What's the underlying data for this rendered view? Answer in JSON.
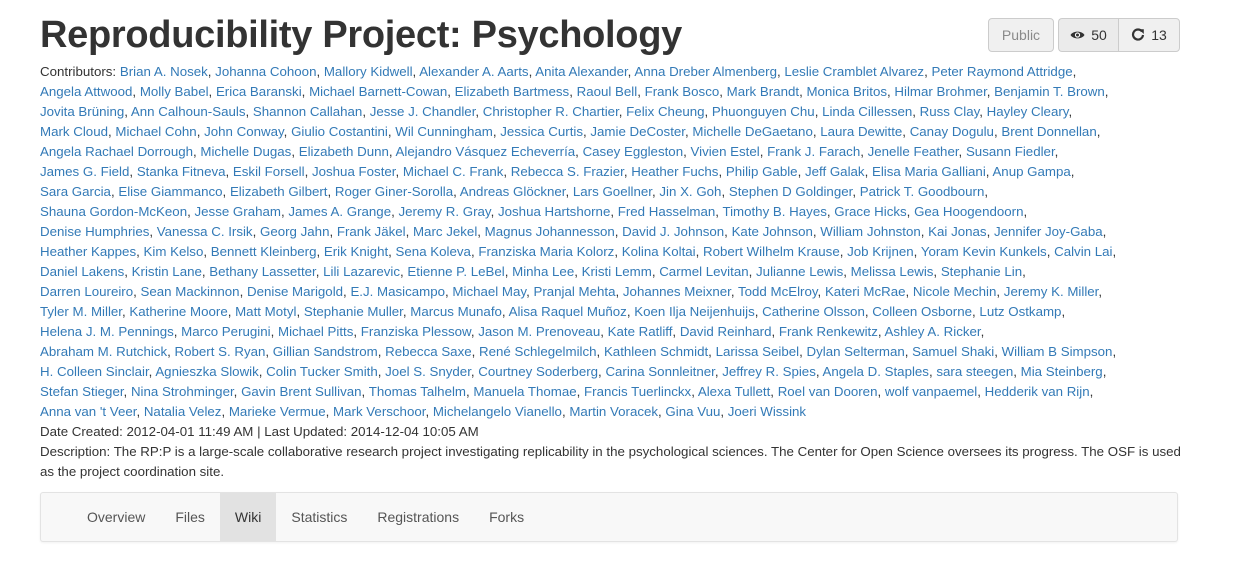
{
  "project": {
    "title": "Reproducibility Project: Psychology"
  },
  "actions": {
    "public_label": "Public",
    "watch_count": "50",
    "fork_count": "13"
  },
  "contributors": {
    "label": "Contributors:",
    "lines": [
      [
        "Brian A. Nosek",
        "Johanna Cohoon",
        "Mallory Kidwell",
        "Alexander A. Aarts",
        "Anita Alexander",
        "Anna Dreber Almenberg",
        "Leslie Cramblet Alvarez",
        "Peter Raymond Attridge"
      ],
      [
        "Angela Attwood",
        "Molly Babel",
        "Erica Baranski",
        "Michael Barnett-Cowan",
        "Elizabeth Bartmess",
        "Raoul Bell",
        "Frank Bosco",
        "Mark Brandt",
        "Monica Britos",
        "Hilmar Brohmer",
        "Benjamin T. Brown"
      ],
      [
        "Jovita Brüning",
        "Ann Calhoun-Sauls",
        "Shannon Callahan",
        "Jesse J. Chandler",
        "Christopher R. Chartier",
        "Felix Cheung",
        "Phuonguyen Chu",
        "Linda Cillessen",
        "Russ Clay",
        "Hayley Cleary"
      ],
      [
        "Mark Cloud",
        "Michael Cohn",
        "John Conway",
        "Giulio Costantini",
        "Wil Cunningham",
        "Jessica Curtis",
        "Jamie DeCoster",
        "Michelle DeGaetano",
        "Laura Dewitte",
        "Canay Dogulu",
        "Brent Donnellan"
      ],
      [
        "Angela Rachael Dorrough",
        "Michelle Dugas",
        "Elizabeth Dunn",
        "Alejandro Vásquez Echeverría",
        "Casey Eggleston",
        "Vivien Estel",
        "Frank J. Farach",
        "Jenelle Feather",
        "Susann Fiedler"
      ],
      [
        "James G. Field",
        "Stanka Fitneva",
        "Eskil Forsell",
        "Joshua Foster",
        "Michael C. Frank",
        "Rebecca S. Frazier",
        "Heather Fuchs",
        "Philip Gable",
        "Jeff Galak",
        "Elisa Maria Galliani",
        "Anup Gampa"
      ],
      [
        "Sara Garcia",
        "Elise Giammanco",
        "Elizabeth Gilbert",
        "Roger Giner-Sorolla",
        "Andreas Glöckner",
        "Lars Goellner",
        "Jin X. Goh",
        "Stephen D Goldinger",
        "Patrick T. Goodbourn"
      ],
      [
        "Shauna Gordon-McKeon",
        "Jesse Graham",
        "James A. Grange",
        "Jeremy R. Gray",
        "Joshua Hartshorne",
        "Fred Hasselman",
        "Timothy B. Hayes",
        "Grace Hicks",
        "Gea Hoogendoorn"
      ],
      [
        "Denise Humphries",
        "Vanessa C. Irsik",
        "Georg Jahn",
        "Frank Jäkel",
        "Marc Jekel",
        "Magnus Johannesson",
        "David J. Johnson",
        "Kate Johnson",
        "William Johnston",
        "Kai Jonas",
        "Jennifer Joy-Gaba"
      ],
      [
        "Heather Kappes",
        "Kim Kelso",
        "Bennett Kleinberg",
        "Erik Knight",
        "Sena Koleva",
        "Franziska Maria Kolorz",
        "Kolina Koltai",
        "Robert Wilhelm Krause",
        "Job Krijnen",
        "Yoram Kevin Kunkels",
        "Calvin Lai"
      ],
      [
        "Daniel Lakens",
        "Kristin Lane",
        "Bethany Lassetter",
        "Lili Lazarevic",
        "Etienne P. LeBel",
        "Minha Lee",
        "Kristi Lemm",
        "Carmel Levitan",
        "Julianne Lewis",
        "Melissa Lewis",
        "Stephanie Lin"
      ],
      [
        "Darren Loureiro",
        "Sean Mackinnon",
        "Denise Marigold",
        "E.J. Masicampo",
        "Michael May",
        "Pranjal Mehta",
        "Johannes Meixner",
        "Todd McElroy",
        "Kateri McRae",
        "Nicole Mechin",
        "Jeremy K. Miller"
      ],
      [
        "Tyler M. Miller",
        "Katherine Moore",
        "Matt Motyl",
        "Stephanie Muller",
        "Marcus Munafo",
        "Alisa Raquel Muñoz",
        "Koen Ilja Neijenhuijs",
        "Catherine Olsson",
        "Colleen Osborne",
        "Lutz Ostkamp"
      ],
      [
        "Helena J. M. Pennings",
        "Marco Perugini",
        "Michael Pitts",
        "Franziska Plessow",
        "Jason M. Prenoveau",
        "Kate Ratliff",
        "David Reinhard",
        "Frank Renkewitz",
        "Ashley A. Ricker"
      ],
      [
        "Abraham M. Rutchick",
        "Robert S. Ryan",
        "Gillian Sandstrom",
        "Rebecca Saxe",
        "René Schlegelmilch",
        "Kathleen Schmidt",
        "Larissa Seibel",
        "Dylan Selterman",
        "Samuel Shaki",
        "William B Simpson"
      ],
      [
        "H. Colleen Sinclair",
        "Agnieszka Slowik",
        "Colin Tucker Smith",
        "Joel S. Snyder",
        "Courtney Soderberg",
        "Carina Sonnleitner",
        "Jeffrey R. Spies",
        "Angela D. Staples",
        "sara steegen",
        "Mia Steinberg"
      ],
      [
        "Stefan Stieger",
        "Nina Strohminger",
        "Gavin Brent Sullivan",
        "Thomas Talhelm",
        "Manuela Thomae",
        "Francis Tuerlinckx",
        "Alexa Tullett",
        "Roel van Dooren",
        "wolf vanpaemel",
        "Hedderik van Rijn"
      ],
      [
        "Anna van 't Veer",
        "Natalia Velez",
        "Marieke Vermue",
        "Mark Verschoor",
        "Michelangelo Vianello",
        "Martin Voracek",
        "Gina Vuu",
        "Joeri Wissink"
      ]
    ]
  },
  "dates": {
    "created_label": "Date Created:",
    "created": "2012-04-01 11:49 AM",
    "divider": "|",
    "updated_label": "Last Updated:",
    "updated": "2014-12-04 10:05 AM"
  },
  "description": {
    "label": "Description:",
    "text": "The RP:P is a large-scale collaborative research project investigating replicability in the psychological sciences. The Center for Open Science oversees its progress. The OSF is used as the project coordination site."
  },
  "nav": {
    "tabs": [
      "Overview",
      "Files",
      "Wiki",
      "Statistics",
      "Registrations",
      "Forks"
    ],
    "active": "Wiki"
  },
  "icons": {
    "watch": "eye-icon",
    "fork": "fork-icon"
  }
}
